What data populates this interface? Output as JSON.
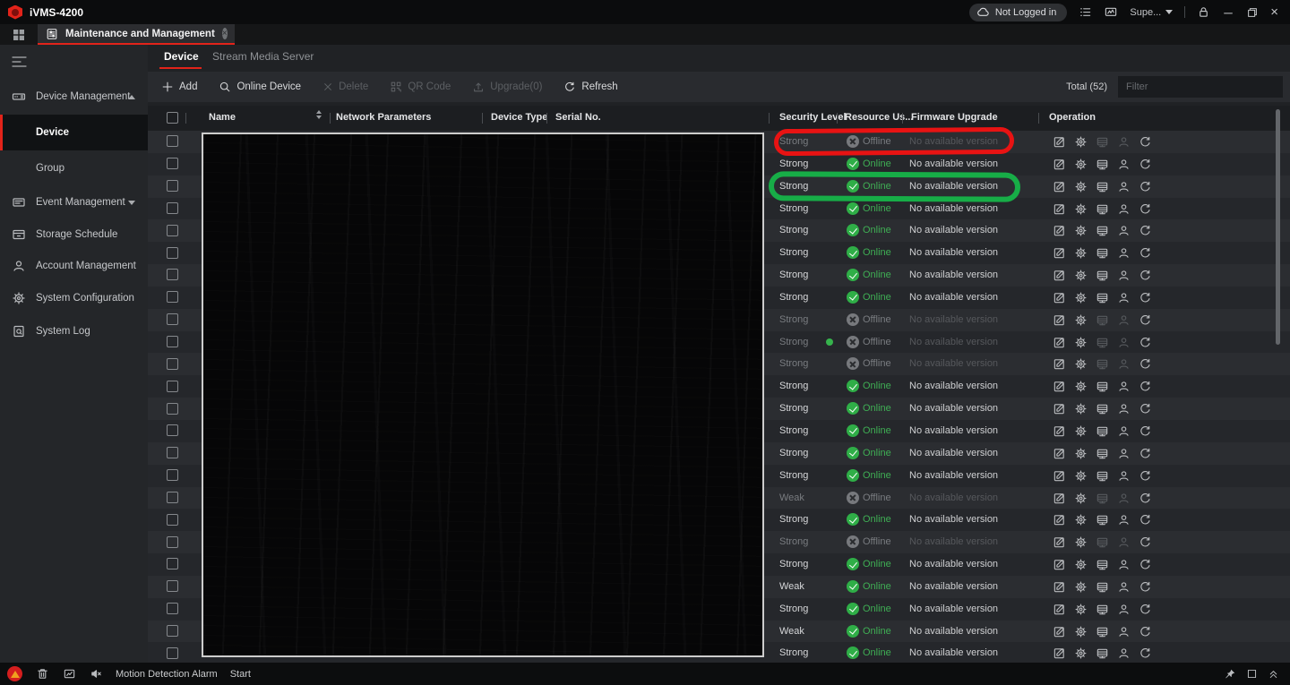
{
  "window": {
    "app_title": "iVMS-4200",
    "login_status": "Not Logged in",
    "user_label": "Supe...",
    "workspace_tab": "Maintenance and Management",
    "control_icons": [
      "alarm-list-icon",
      "monitor-icon",
      "lock-icon",
      "minimize-icon",
      "restore-icon",
      "close-icon"
    ]
  },
  "sidebar": {
    "items": [
      {
        "label": "Device Management",
        "expanded": true
      },
      {
        "label": "Device",
        "selected": true
      },
      {
        "label": "Group"
      },
      {
        "label": "Event Management",
        "expanded": false
      },
      {
        "label": "Storage Schedule"
      },
      {
        "label": "Account Management"
      },
      {
        "label": "System Configuration"
      },
      {
        "label": "System Log"
      }
    ]
  },
  "content": {
    "tabs": [
      {
        "label": "Device",
        "active": true
      },
      {
        "label": "Stream Media Server",
        "active": false
      }
    ],
    "toolbar": {
      "add": "Add",
      "online_device": "Online Device",
      "delete": "Delete",
      "qr_code": "QR Code",
      "upgrade": "Upgrade(0)",
      "refresh": "Refresh",
      "total": "Total (52)",
      "filter_placeholder": "Filter"
    },
    "table": {
      "headers": {
        "name": "Name",
        "network": "Network Parameters",
        "device_type": "Device Type",
        "serial": "Serial No.",
        "security": "Security Level",
        "resource": "Resource Us...",
        "firmware": "Firmware Upgrade",
        "operation": "Operation"
      },
      "operation_icons": [
        "edit-icon",
        "remote-config-icon",
        "storage-config-icon",
        "user-icon",
        "refresh-icon"
      ],
      "rows": [
        {
          "security": "Strong",
          "status": "Offline",
          "firmware": "No available version"
        },
        {
          "security": "Strong",
          "status": "Online",
          "firmware": "No available version"
        },
        {
          "security": "Strong",
          "status": "Online",
          "firmware": "No available version"
        },
        {
          "security": "Strong",
          "status": "Online",
          "firmware": "No available version"
        },
        {
          "security": "Strong",
          "status": "Online",
          "firmware": "No available version"
        },
        {
          "security": "Strong",
          "status": "Online",
          "firmware": "No available version"
        },
        {
          "security": "Strong",
          "status": "Online",
          "firmware": "No available version"
        },
        {
          "security": "Strong",
          "status": "Online",
          "firmware": "No available version"
        },
        {
          "security": "Strong",
          "status": "Offline",
          "firmware": "No available version"
        },
        {
          "security": "Strong",
          "status": "Offline",
          "firmware": "No available version",
          "dot": true
        },
        {
          "security": "Strong",
          "status": "Offline",
          "firmware": "No available version"
        },
        {
          "security": "Strong",
          "status": "Online",
          "firmware": "No available version"
        },
        {
          "security": "Strong",
          "status": "Online",
          "firmware": "No available version"
        },
        {
          "security": "Strong",
          "status": "Online",
          "firmware": "No available version"
        },
        {
          "security": "Strong",
          "status": "Online",
          "firmware": "No available version"
        },
        {
          "security": "Strong",
          "status": "Online",
          "firmware": "No available version"
        },
        {
          "security": "Weak",
          "status": "Offline",
          "firmware": "No available version"
        },
        {
          "security": "Strong",
          "status": "Online",
          "firmware": "No available version"
        },
        {
          "security": "Strong",
          "status": "Offline",
          "firmware": "No available version"
        },
        {
          "security": "Strong",
          "status": "Online",
          "firmware": "No available version"
        },
        {
          "security": "Weak",
          "status": "Online",
          "firmware": "No available version"
        },
        {
          "security": "Strong",
          "status": "Online",
          "firmware": "No available version"
        },
        {
          "security": "Weak",
          "status": "Online",
          "firmware": "No available version"
        },
        {
          "security": "Strong",
          "status": "Online",
          "firmware": "No available version"
        }
      ]
    }
  },
  "annotations": {
    "red_box_row": 1,
    "green_box_row": 3,
    "green_dot_row": 10,
    "redaction": "large black box covering Name / Network Parameters / Device Type / Serial No. columns"
  },
  "status_bar": {
    "alarm_label": "Motion Detection Alarm",
    "alarm_action": "Start",
    "icons": [
      "alarm-badge-icon",
      "trash-icon",
      "alarm-output-icon",
      "speaker-mute-icon",
      "pin-icon",
      "window-icon",
      "collapse-up-icon"
    ]
  },
  "colors": {
    "accent_red": "#e2231a",
    "online_green": "#2fae47",
    "offline_gray": "#77797d",
    "annotation_red": "#e81313",
    "annotation_green": "#17ad47",
    "redaction_border": "#cdcdcd"
  }
}
